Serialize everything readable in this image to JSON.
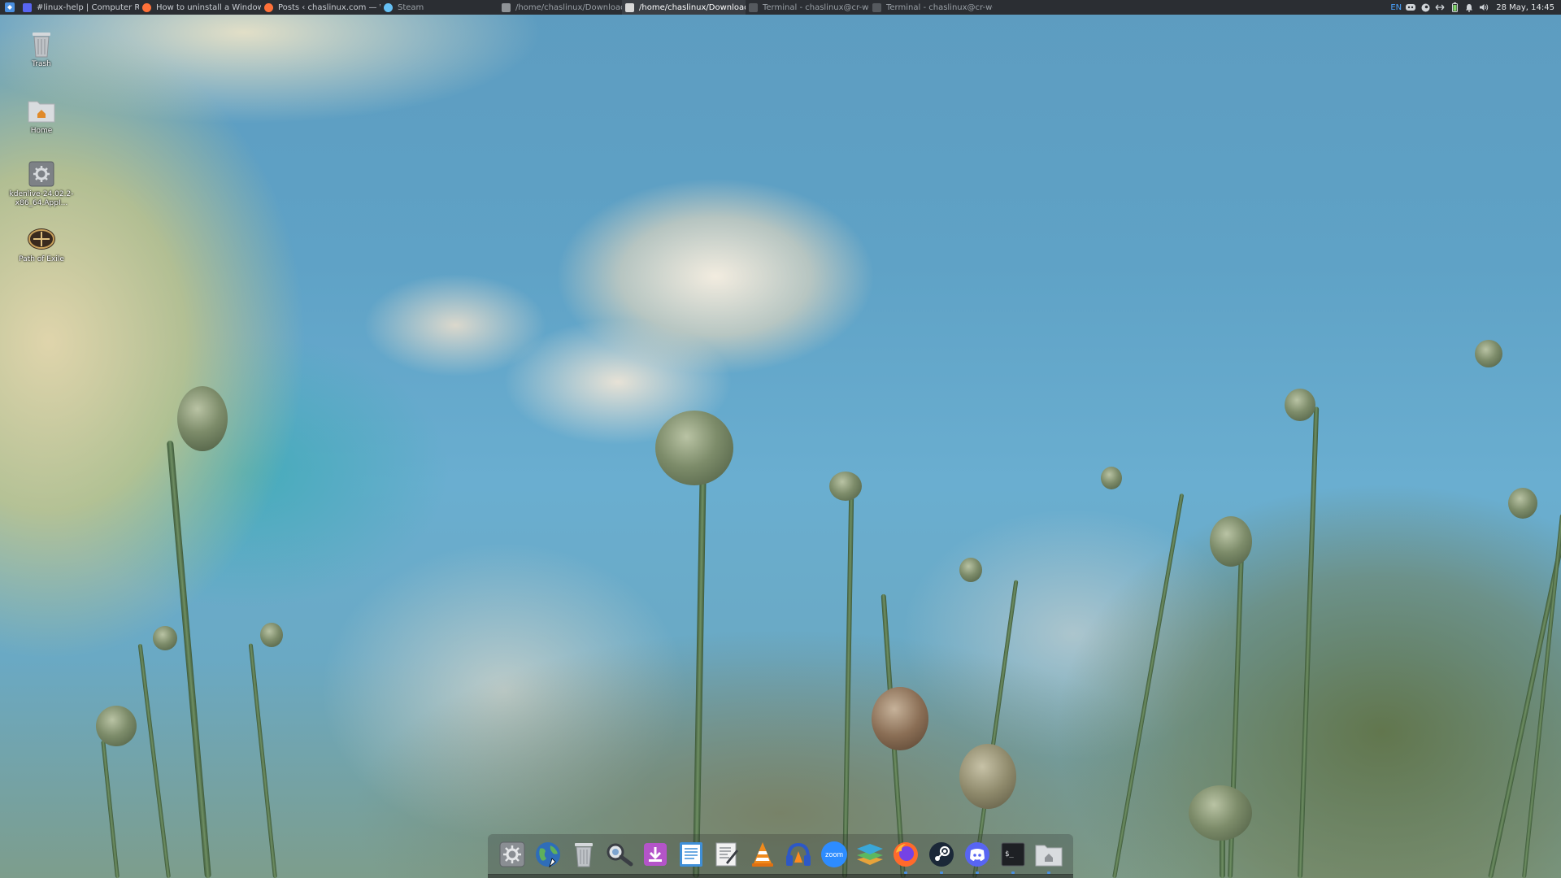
{
  "top_panel": {
    "launcher_icon": "app-menu-icon",
    "tasks": [
      {
        "label": "#linux-help | Computer Rec...",
        "icon": "discord-icon",
        "icon_color": "#5865F2",
        "state": "normal"
      },
      {
        "label": "How to uninstall a Windows ...",
        "icon": "firefox-icon",
        "icon_color": "#ff7139",
        "state": "normal"
      },
      {
        "label": "Posts ‹ chaslinux.com — Wo...",
        "icon": "firefox-icon",
        "icon_color": "#ff7139",
        "state": "normal"
      },
      {
        "label": "Steam",
        "icon": "steam-icon",
        "icon_color": "#66c0f4",
        "state": "dim"
      },
      {
        "label": "/home/chaslinux/Downloads",
        "icon": "folder-icon",
        "icon_color": "#b0b4b8",
        "state": "dim"
      },
      {
        "label": "/home/chaslinux/Downloads",
        "icon": "folder-icon",
        "icon_color": "#d8d8d8",
        "state": "active"
      },
      {
        "label": "Terminal - chaslinux@cr-wor...",
        "icon": "terminal-icon",
        "icon_color": "#9aa0a6",
        "state": "dim"
      },
      {
        "label": "Terminal - chaslinux@cr-wor...",
        "icon": "terminal-icon",
        "icon_color": "#9aa0a6",
        "state": "dim"
      }
    ],
    "tray": {
      "keyboard_layout": "EN",
      "icons": [
        "discord-tray-icon",
        "steam-tray-icon",
        "network-icon",
        "battery-icon",
        "notification-bell-icon",
        "volume-icon"
      ],
      "clock": "28 May, 14:45"
    }
  },
  "desktop_icons": [
    {
      "label": "Trash",
      "icon": "trash-icon"
    },
    {
      "label": "Home",
      "icon": "home-folder-icon"
    },
    {
      "label": "kdenlive-24.02.2-x86_64.AppI...",
      "icon": "appimage-gear-icon"
    },
    {
      "label": "Path of Exile",
      "icon": "path-of-exile-icon"
    }
  ],
  "dock_items": [
    {
      "name": "settings",
      "icon": "settings-gear-icon",
      "running": false
    },
    {
      "name": "web-browser",
      "icon": "globe-icon",
      "running": false
    },
    {
      "name": "trash",
      "icon": "trash-icon",
      "running": false
    },
    {
      "name": "image-viewer",
      "icon": "magnifier-icon",
      "running": false
    },
    {
      "name": "downloader",
      "icon": "download-icon",
      "running": false
    },
    {
      "name": "document-viewer",
      "icon": "document-icon",
      "running": false
    },
    {
      "name": "text-editor",
      "icon": "text-editor-icon",
      "running": false
    },
    {
      "name": "vlc",
      "icon": "vlc-cone-icon",
      "running": false
    },
    {
      "name": "audio-player",
      "icon": "headphones-icon",
      "running": false
    },
    {
      "name": "zoom",
      "icon": "zoom-icon",
      "label": "zoom",
      "running": false
    },
    {
      "name": "layers-app",
      "icon": "layers-icon",
      "running": false
    },
    {
      "name": "firefox",
      "icon": "firefox-icon",
      "running": true
    },
    {
      "name": "steam",
      "icon": "steam-icon",
      "running": true
    },
    {
      "name": "discord",
      "icon": "discord-icon",
      "running": true
    },
    {
      "name": "terminal",
      "icon": "terminal-icon",
      "label": "$_",
      "running": true
    },
    {
      "name": "file-manager",
      "icon": "home-folder-icon",
      "running": true
    }
  ],
  "colors": {
    "panel_bg": "#2b2e33",
    "accent_indicator": "#4a8fe0"
  }
}
